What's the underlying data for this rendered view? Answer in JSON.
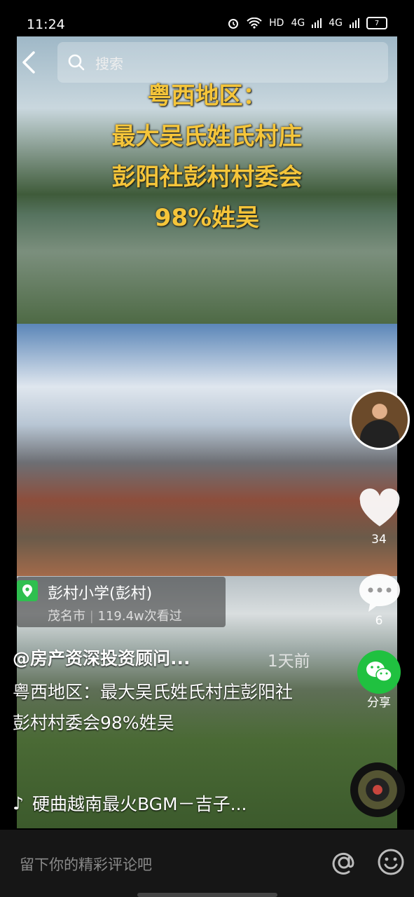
{
  "status_bar": {
    "time": "11:24",
    "network_label": "HD",
    "signal1": "4G",
    "signal2": "4G",
    "battery": "7"
  },
  "search": {
    "placeholder": "搜索"
  },
  "video_overlay_lines": [
    "粤西地区：",
    "最大吴氏姓氏村庄",
    "彭阳社彭村村委会",
    "98%姓吴"
  ],
  "actions": {
    "like_count": "34",
    "comment_count": "6",
    "share_label": "分享"
  },
  "location": {
    "name": "彭村小学(彭村)",
    "city": "茂名市",
    "views": "119.4w次看过"
  },
  "post": {
    "author": "@房产资深投资顾问...",
    "time_ago": "1天前",
    "description": "粤西地区：最大吴氏姓氏村庄彭阳社彭村村委会98%姓吴",
    "music": "硬曲越南最火BGM－吉子..."
  },
  "comment_bar": {
    "placeholder": "留下你的精彩评论吧"
  },
  "colors": {
    "share_green": "#20c140",
    "overlay_text": "#f5c53a"
  }
}
